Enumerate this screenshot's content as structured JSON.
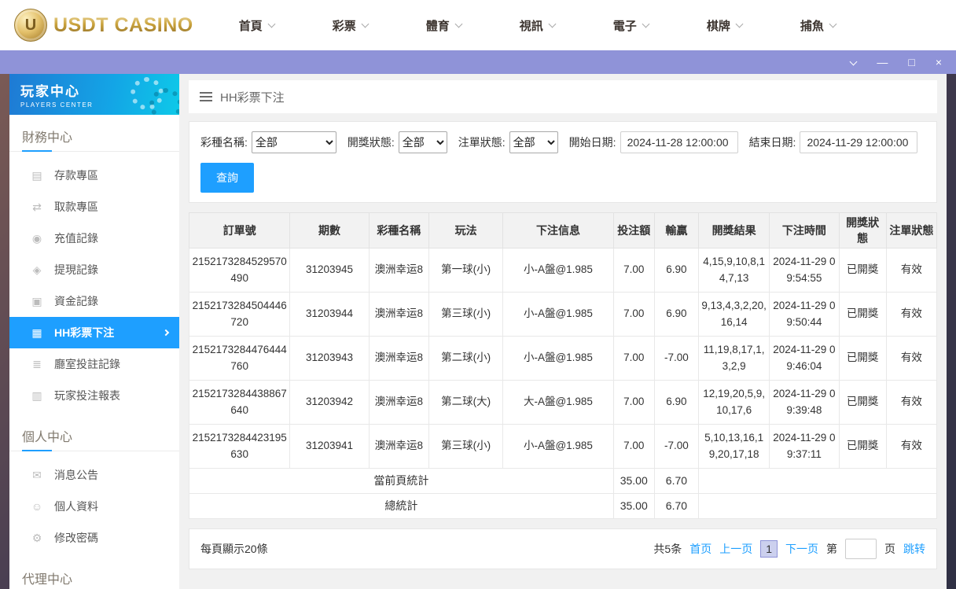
{
  "colors": {
    "accent": "#1e9fff",
    "titlebar_purple": "#8f93d8",
    "logo_gold": "#c9a23b",
    "active_item_bg": "#1e9fff"
  },
  "icons": {
    "minimize": "—",
    "maximize": "□",
    "close": "×",
    "deposit": "▤",
    "withdraw": "⇄",
    "recharge": "◉",
    "cashout": "◈",
    "funds": "▣",
    "lottery": "▦",
    "room": "≣",
    "report": "▥",
    "message": "✉",
    "profile": "☺",
    "password": "⚙"
  },
  "topbar": {
    "logo_text": "USDT CASINO",
    "logo_coin_letter": "U",
    "nav": [
      {
        "label": "首頁"
      },
      {
        "label": "彩票"
      },
      {
        "label": "體育"
      },
      {
        "label": "視訊"
      },
      {
        "label": "電子"
      },
      {
        "label": "棋牌"
      },
      {
        "label": "捕魚"
      }
    ]
  },
  "sidebar": {
    "header_title": "玩家中心",
    "header_subtitle": "PLAYERS CENTER",
    "sections": [
      {
        "title": "財務中心",
        "items": [
          {
            "label": "存款專區"
          },
          {
            "label": "取款專區"
          },
          {
            "label": "充值記錄"
          },
          {
            "label": "提現記錄"
          },
          {
            "label": "資金記錄"
          },
          {
            "label": "HH彩票下注",
            "active": true
          },
          {
            "label": "廳室投註記錄"
          },
          {
            "label": "玩家投注報表"
          }
        ]
      },
      {
        "title": "個人中心",
        "items": [
          {
            "label": "消息公告"
          },
          {
            "label": "個人資料"
          },
          {
            "label": "修改密碼"
          }
        ]
      },
      {
        "title": "代理中心",
        "items": []
      }
    ]
  },
  "page_header": {
    "title": "HH彩票下注"
  },
  "filters": {
    "lottery": {
      "label": "彩種名稱:",
      "value": "全部"
    },
    "draw_status": {
      "label": "開獎狀態:",
      "value": "全部"
    },
    "order_status": {
      "label": "注單狀態:",
      "value": "全部"
    },
    "start_date": {
      "label": "開始日期:",
      "value": "2024-11-28 12:00:00"
    },
    "end_date": {
      "label": "結束日期:",
      "value": "2024-11-29 12:00:00"
    },
    "search": "查詢"
  },
  "table": {
    "columns": [
      "訂單號",
      "期數",
      "彩種名稱",
      "玩法",
      "下注信息",
      "投注額",
      "輸贏",
      "開獎結果",
      "下注時間",
      "開獎狀態",
      "注單狀態"
    ],
    "rows": [
      [
        "2152173284529570490",
        "31203945",
        "澳洲幸运8",
        "第一球(小)",
        "小-A盤@1.985",
        "7.00",
        "6.90",
        "4,15,9,10,8,14,7,13",
        "2024-11-29 09:54:55",
        "已開獎",
        "有效"
      ],
      [
        "2152173284504446720",
        "31203944",
        "澳洲幸运8",
        "第三球(小)",
        "小-A盤@1.985",
        "7.00",
        "6.90",
        "9,13,4,3,2,20,16,14",
        "2024-11-29 09:50:44",
        "已開獎",
        "有效"
      ],
      [
        "2152173284476444760",
        "31203943",
        "澳洲幸运8",
        "第二球(小)",
        "小-A盤@1.985",
        "7.00",
        "-7.00",
        "11,19,8,17,1,3,2,9",
        "2024-11-29 09:46:04",
        "已開獎",
        "有效"
      ],
      [
        "2152173284438867640",
        "31203942",
        "澳洲幸运8",
        "第二球(大)",
        "大-A盤@1.985",
        "7.00",
        "6.90",
        "12,19,20,5,9,10,17,6",
        "2024-11-29 09:39:48",
        "已開獎",
        "有效"
      ],
      [
        "2152173284423195630",
        "31203941",
        "澳洲幸运8",
        "第三球(小)",
        "小-A盤@1.985",
        "7.00",
        "-7.00",
        "5,10,13,16,19,20,17,18",
        "2024-11-29 09:37:11",
        "已開獎",
        "有效"
      ]
    ]
  },
  "summary": {
    "page": {
      "label": "當前頁統計",
      "bet": "35.00",
      "win": "6.70"
    },
    "total": {
      "label": "總統計",
      "bet": "35.00",
      "win": "6.70"
    }
  },
  "pagination": {
    "per_page": "每頁顯示20條",
    "total": "共5条",
    "first": "首页",
    "prev": "上一页",
    "current": "1",
    "next": "下一页",
    "jump_prefix": "第",
    "jump_suffix": "页",
    "jump_action": "跳转"
  }
}
